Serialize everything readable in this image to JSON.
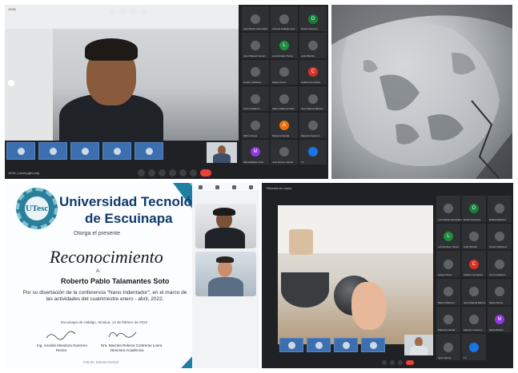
{
  "top_left_meet": {
    "clock": "10:51",
    "bottom_label": "10:51 | ceres-igim-wej",
    "participants": [
      {
        "name": "Luis Daniel Hernández",
        "initial": "",
        "color": "#5f6368"
      },
      {
        "name": "Antonio Hidalgo Lara",
        "initial": "",
        "color": "#5f6368"
      },
      {
        "name": "Daniel Guerrero",
        "initial": "D",
        "color": "#188038"
      },
      {
        "name": "Juan Manuel Gómez",
        "initial": "",
        "color": "#5f6368"
      },
      {
        "name": "Luis Enrique Torres",
        "initial": "L",
        "color": "#1e8e3e"
      },
      {
        "name": "Andy Bonilla",
        "initial": "",
        "color": "#5f6368"
      },
      {
        "name": "Carlos Quiñónez",
        "initial": "",
        "color": "#5f6368"
      },
      {
        "name": "Sergio Pérez",
        "initial": "",
        "color": "#5f6368"
      },
      {
        "name": "Gabriel Cervantes",
        "initial": "C",
        "color": "#d93025"
      },
      {
        "name": "Kevin Calderón",
        "initial": "",
        "color": "#5f6368"
      },
      {
        "name": "Martín Martínez Ruiz",
        "initial": "",
        "color": "#5f6368"
      },
      {
        "name": "Juan Manuel Barrios",
        "initial": "",
        "color": "#5f6368"
      },
      {
        "name": "Mario Osuna",
        "initial": "",
        "color": "#5f6368"
      },
      {
        "name": "Maria Fernanda",
        "initial": "A",
        "color": "#e8710a"
      },
      {
        "name": "Marcelo Guerrero",
        "initial": "",
        "color": "#5f6368"
      },
      {
        "name": "Maria Beltrán Ortiz",
        "initial": "M",
        "color": "#9334e6"
      },
      {
        "name": "José Alonso García",
        "initial": "",
        "color": "#5f6368"
      },
      {
        "name": "Tú",
        "initial": "",
        "color": "#1a73e8"
      }
    ]
  },
  "microscopy": {
    "label": ""
  },
  "certificate": {
    "logo_text": "UTesc",
    "university_line1": "Universidad Tecnológica",
    "university_line2": "de Escuinapa",
    "otorga": "Otorga el presente",
    "reconocimiento": "Reconocimiento",
    "a": "A:",
    "recipient": "Roberto Pablo Talamantes Soto",
    "description": "Por su disertación de la conferencia \"Nano Indentador\", en el marco de las actividades del cuatrimestre enero - abril, 2022.",
    "date_line": "Escuinapa de Hidalgo, Sinaloa, 14 de febrero de 2022",
    "signer1_name": "Ing. Arnoldo Mendoza Guerrero",
    "signer1_role": "Rector",
    "signer2_name": "Dra. Marcela Rebeca Contreras Loera",
    "signer2_role": "Directora Académica",
    "footer": "FOLIO: 9/2022-NOCE"
  },
  "bottom_right_meet": {
    "header": "Reunión en curso",
    "participants": [
      {
        "name": "Luis Daniel Hernández",
        "initial": "",
        "color": "#5f6368"
      },
      {
        "name": "Daniel Guerrero",
        "initial": "D",
        "color": "#188038"
      },
      {
        "name": "Rafael Martínez",
        "initial": "",
        "color": "#5f6368"
      },
      {
        "name": "Luis Enrique Torres",
        "initial": "L",
        "color": "#1e8e3e"
      },
      {
        "name": "Andy Bonilla",
        "initial": "",
        "color": "#5f6368"
      },
      {
        "name": "Carlos Quiñónez",
        "initial": "",
        "color": "#5f6368"
      },
      {
        "name": "Sergio Pérez",
        "initial": "",
        "color": "#5f6368"
      },
      {
        "name": "Gabriel Cervantes",
        "initial": "C",
        "color": "#d93025"
      },
      {
        "name": "Kevin Calderón",
        "initial": "",
        "color": "#5f6368"
      },
      {
        "name": "Martín Martínez",
        "initial": "",
        "color": "#5f6368"
      },
      {
        "name": "Juan Manuel Barrios",
        "initial": "",
        "color": "#5f6368"
      },
      {
        "name": "Mario Osuna",
        "initial": "",
        "color": "#5f6368"
      },
      {
        "name": "Maria Fernanda",
        "initial": "",
        "color": "#5f6368"
      },
      {
        "name": "Marcelo Guerrero",
        "initial": "",
        "color": "#5f6368"
      },
      {
        "name": "Maria Beltrán",
        "initial": "M",
        "color": "#9334e6"
      },
      {
        "name": "José García",
        "initial": "",
        "color": "#5f6368"
      },
      {
        "name": "Tú",
        "initial": "",
        "color": "#1a73e8"
      }
    ]
  }
}
